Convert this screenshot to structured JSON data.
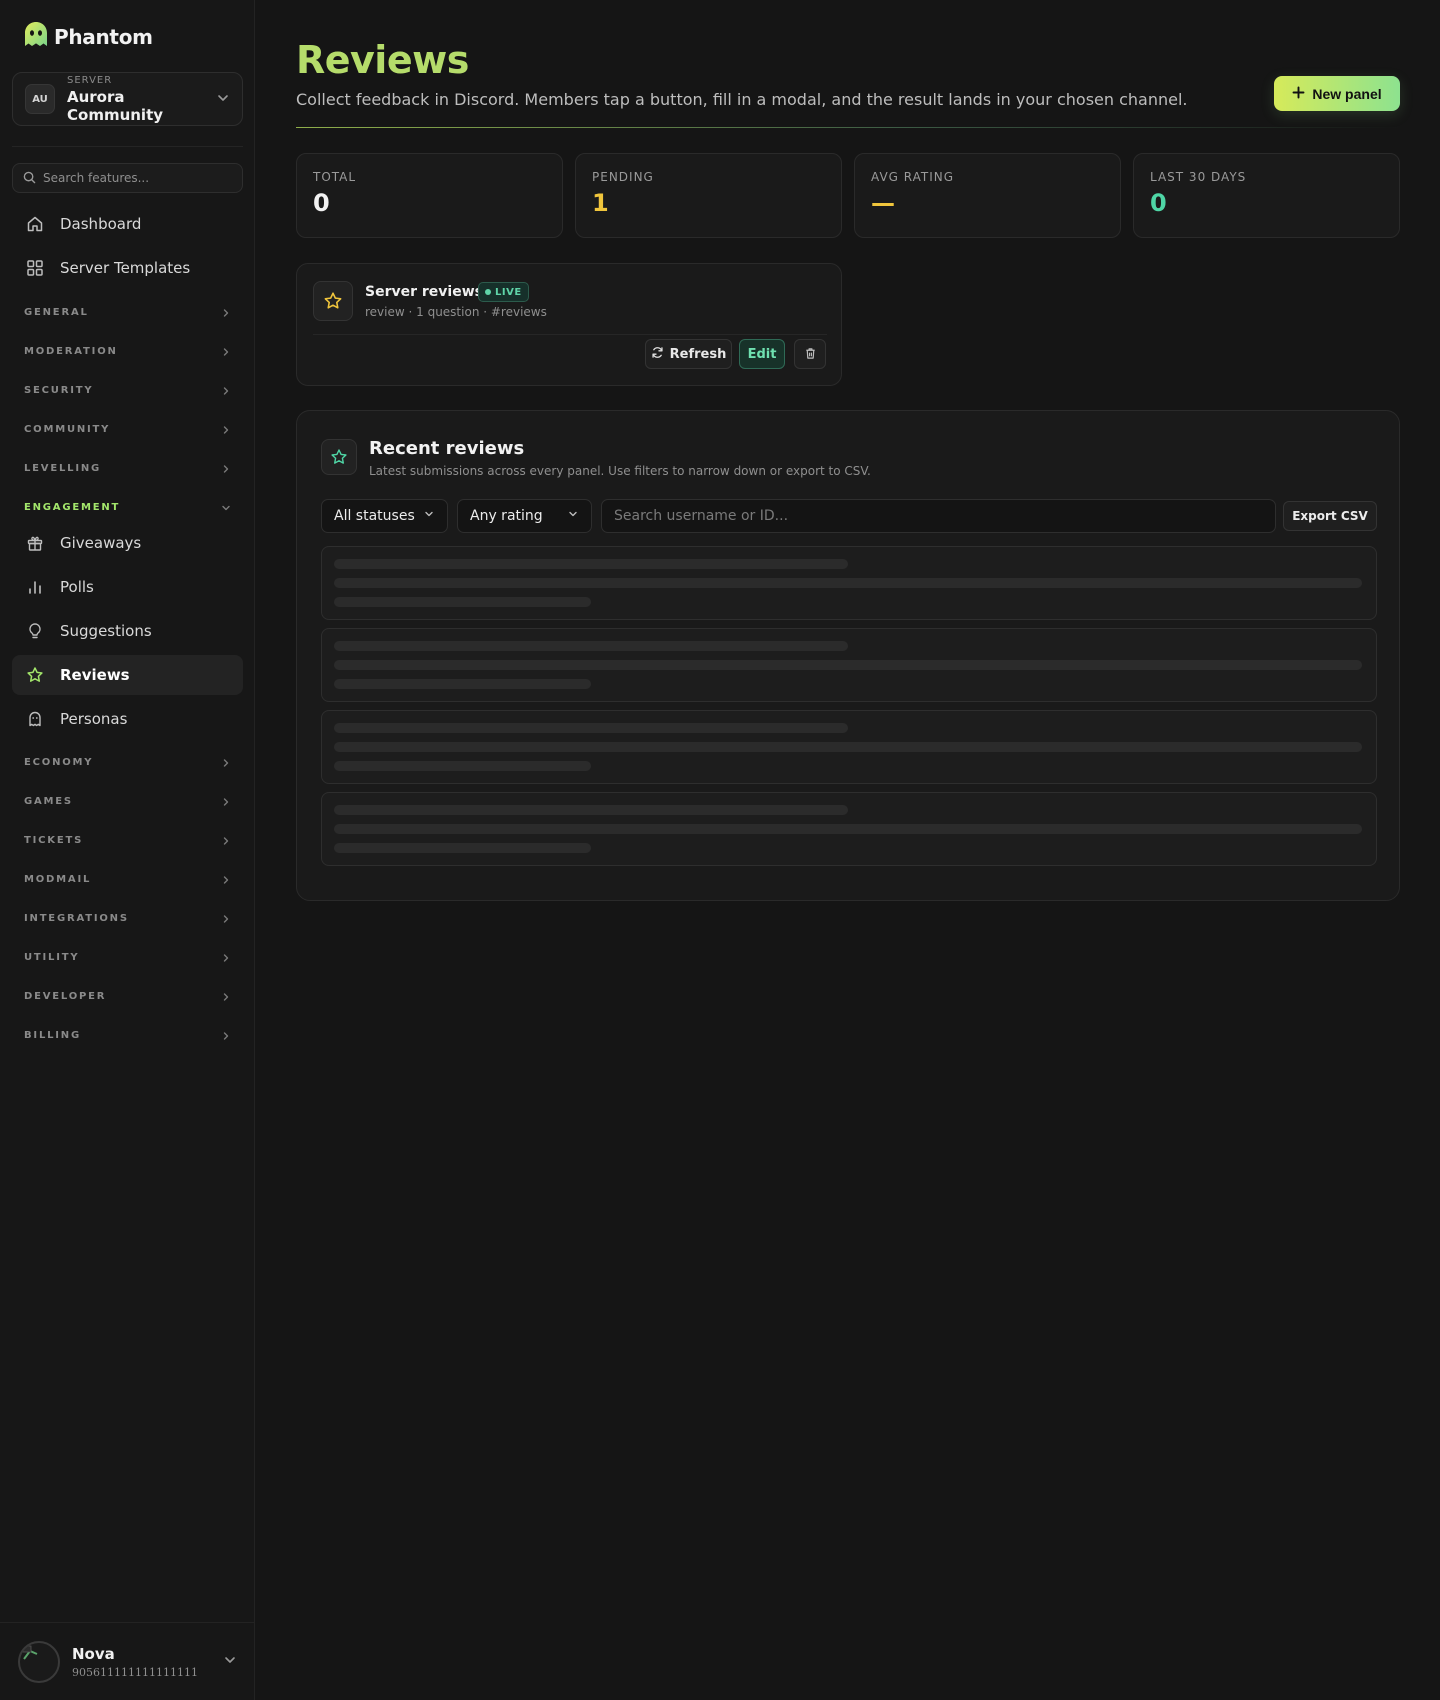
{
  "brand": {
    "name": "Phantom"
  },
  "server": {
    "initials": "AU",
    "caption": "SERVER",
    "name": "Aurora Community"
  },
  "search": {
    "placeholder": "Search features..."
  },
  "nav_top": [
    {
      "label": "Dashboard",
      "icon": "home-icon"
    },
    {
      "label": "Server Templates",
      "icon": "grid-icon"
    }
  ],
  "sections": [
    {
      "label": "GENERAL"
    },
    {
      "label": "MODERATION"
    },
    {
      "label": "SECURITY"
    },
    {
      "label": "COMMUNITY"
    },
    {
      "label": "LEVELLING"
    },
    {
      "label": "ENGAGEMENT",
      "open": true
    },
    {
      "label": "ECONOMY"
    },
    {
      "label": "GAMES"
    },
    {
      "label": "TICKETS"
    },
    {
      "label": "MODMAIL"
    },
    {
      "label": "INTEGRATIONS"
    },
    {
      "label": "UTILITY"
    },
    {
      "label": "DEVELOPER"
    },
    {
      "label": "BILLING"
    }
  ],
  "engagement_items": [
    {
      "label": "Giveaways",
      "icon": "gift-icon"
    },
    {
      "label": "Polls",
      "icon": "bar-chart-icon"
    },
    {
      "label": "Suggestions",
      "icon": "lightbulb-icon"
    },
    {
      "label": "Reviews",
      "icon": "star-icon",
      "active": true
    },
    {
      "label": "Personas",
      "icon": "ghost-icon"
    }
  ],
  "user": {
    "name": "Nova",
    "id": "905611111111111111"
  },
  "page": {
    "title": "Reviews",
    "subtitle": "Collect feedback in Discord. Members tap a button, fill in a modal, and the result lands in your chosen channel.",
    "new_button": "New panel"
  },
  "stats": [
    {
      "caption": "TOTAL",
      "value": "0",
      "color": "#f2f2f2"
    },
    {
      "caption": "PENDING",
      "value": "1",
      "color": "#f0c53c"
    },
    {
      "caption": "AVG RATING",
      "value": "—",
      "color": "#f0c53c"
    },
    {
      "caption": "LAST 30 DAYS",
      "value": "0",
      "color": "#4fd6a6"
    }
  ],
  "panel": {
    "name": "Server reviews",
    "badge": "LIVE",
    "meta": "review · 1 question · #reviews",
    "refresh": "Refresh",
    "edit": "Edit"
  },
  "recent": {
    "title": "Recent reviews",
    "subtitle": "Latest submissions across every panel. Use filters to narrow down or export to CSV.",
    "status_filter": "All statuses",
    "rating_filter": "Any rating",
    "search_placeholder": "Search username or ID...",
    "export": "Export CSV",
    "loading_rows": 4
  },
  "colors": {
    "accent": "#b5dc6b",
    "live": "#5fd4a8",
    "pending": "#f0c53c"
  }
}
